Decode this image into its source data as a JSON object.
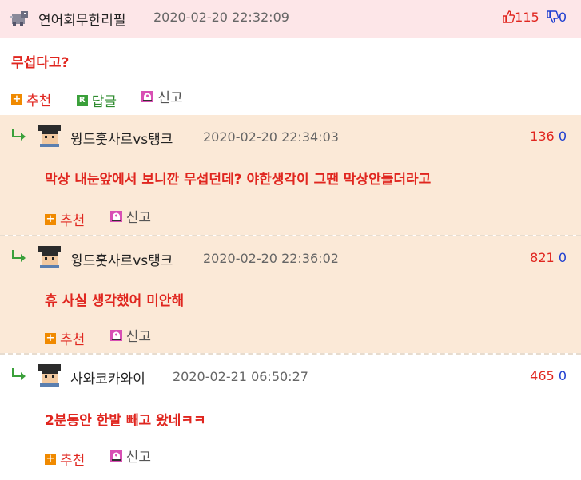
{
  "post": {
    "author": "연어회무한리필",
    "date": "2020-02-20 22:32:09",
    "up": "115",
    "down": "0",
    "body": "무섭다고?",
    "actions": {
      "recommend": "추천",
      "reply": "답글",
      "report": "신고"
    }
  },
  "comments": [
    {
      "author": "윙드훗사르vs탱크",
      "date": "2020-02-20 22:34:03",
      "up": "136",
      "down": "0",
      "body": "막상 내눈앞에서 보니깐 무섭던데? 야한생각이 그땐 막상안들더라고",
      "recommend": "추천",
      "report": "신고"
    },
    {
      "author": "윙드훗사르vs탱크",
      "date": "2020-02-20 22:36:02",
      "up": "821",
      "down": "0",
      "body": "휴 사실 생각했어 미안해",
      "recommend": "추천",
      "report": "신고"
    },
    {
      "author": "사와코카와이",
      "date": "2020-02-21 06:50:27",
      "up": "465",
      "down": "0",
      "body": "2분동안 한발 빼고 왔네ㅋㅋ",
      "recommend": "추천",
      "report": "신고"
    }
  ],
  "colors": {
    "header_bg": "#fde6e8",
    "comment_bg": "#fbe9d7",
    "accent_red": "#e0261f",
    "accent_blue": "#1f3fd0"
  }
}
